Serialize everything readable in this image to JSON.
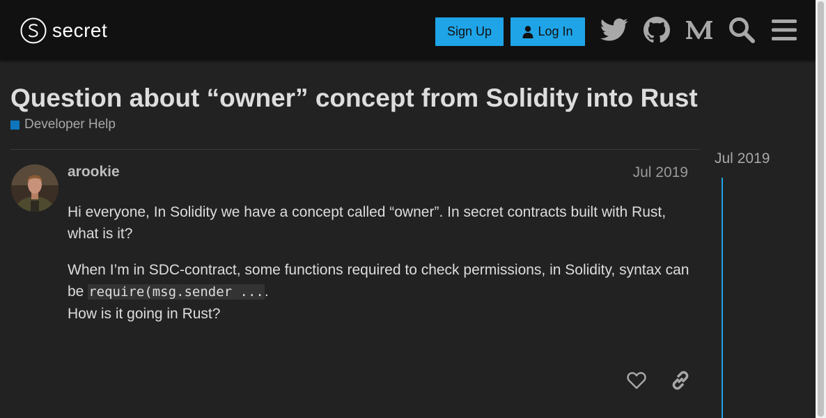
{
  "header": {
    "logo_text": "secret",
    "signup_label": "Sign Up",
    "login_label": "Log In",
    "icons": [
      "twitter-icon",
      "github-icon",
      "medium-icon",
      "search-icon",
      "hamburger-menu-icon"
    ]
  },
  "topic": {
    "title": "Question about “owner” concept from Solidity into Rust",
    "category": "Developer Help",
    "category_color": "#0e76bd"
  },
  "post": {
    "username": "arookie",
    "date": "Jul 2019",
    "para1": "Hi everyone, In Solidity we have a concept called “owner”. In secret contracts built with Rust, what is it?",
    "para2_pre": "When I’m in SDC-contract, some functions required to check permissions, in Solidity, syntax can be ",
    "para2_code": "require(msg.sender ...",
    "para2_post": ".",
    "para3": "How is it going in Rust?"
  },
  "timeline": {
    "date": "Jul 2019"
  },
  "colors": {
    "accent": "#1fa4e8",
    "background": "#222222",
    "header_background": "#111111"
  }
}
